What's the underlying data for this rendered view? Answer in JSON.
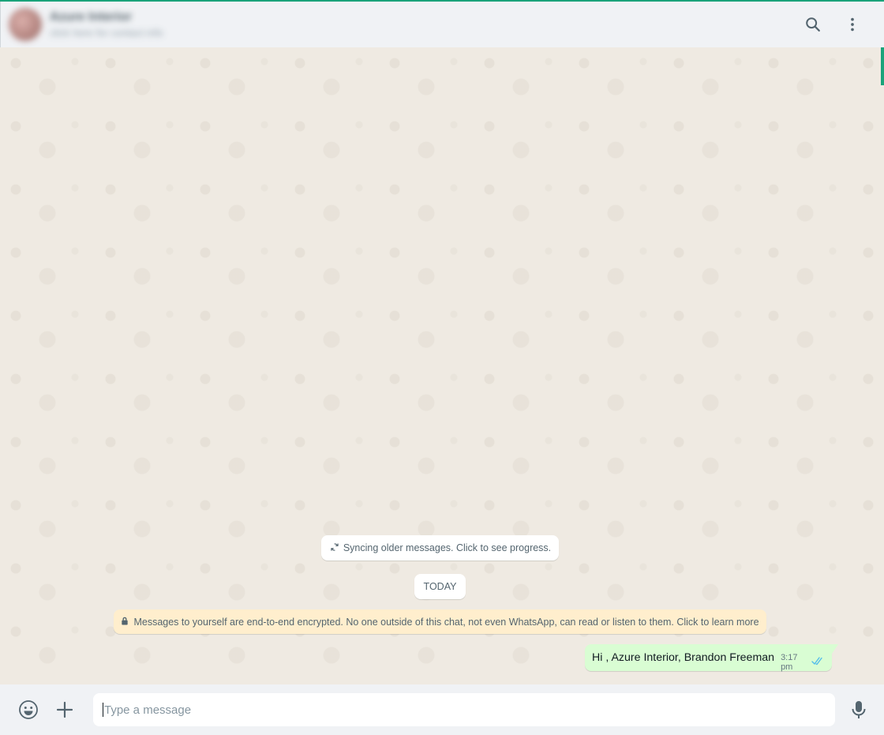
{
  "header": {
    "contact_name": "Azure Interior",
    "contact_status": "click here for contact info",
    "search_icon": "search-icon",
    "menu_icon": "kebab-menu-icon"
  },
  "chat": {
    "sync_notice": "Syncing older messages. Click to see progress.",
    "date_divider": "TODAY",
    "encryption_notice": "Messages to yourself are end-to-end encrypted. No one outside of this chat, not even WhatsApp, can read or listen to them. Click to learn more",
    "messages": [
      {
        "text": "Hi , Azure Interior, Brandon Freeman",
        "time": "3:17 pm",
        "status": "read"
      }
    ]
  },
  "composer": {
    "placeholder": "Type a message",
    "emoji_icon": "emoji-icon",
    "attach_icon": "plus-icon",
    "mic_icon": "microphone-icon"
  },
  "colors": {
    "accent": "#1aa37a",
    "outgoing_bubble": "#d9fdd3",
    "notice_bg": "#ffeecd",
    "read_ticks": "#53bdeb",
    "chat_bg": "#efeae2",
    "panel_bg": "#f0f2f5"
  }
}
